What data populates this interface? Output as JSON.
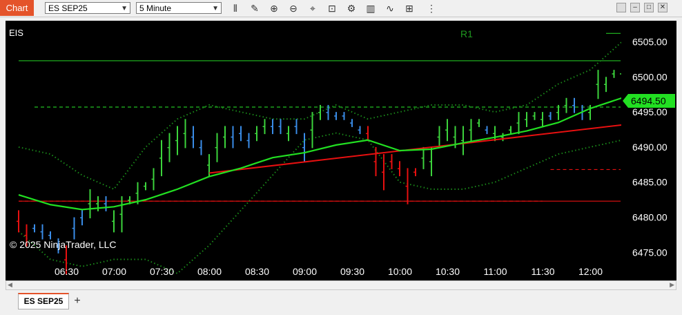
{
  "window": {
    "title": "Chart"
  },
  "toolbar": {
    "instrument": "ES SEP25",
    "interval": "5 Minute",
    "icons": [
      "bar-type-icon",
      "draw-pencil-icon",
      "zoom-in-icon",
      "zoom-out-icon",
      "crosshair-icon",
      "data-box-icon",
      "properties-icon",
      "strategies-icon",
      "indicators-icon",
      "templates-icon",
      "menu-icon"
    ]
  },
  "chart": {
    "instrument_label": "EIS",
    "copyright": "© 2025 NinjaTrader, LLC",
    "pivot_label": "R1",
    "current_price": "6494.50",
    "colors": {
      "up": "#3cd43c",
      "down": "#e81010",
      "neutral": "#3a8de8",
      "ema": "#22e022",
      "trend": "#e81010",
      "bands": "#1a8a1a",
      "current_price_bg": "#22e022"
    }
  },
  "chart_data": {
    "type": "bar",
    "instrument": "ES SEP25",
    "interval": "5 Minute",
    "x_ticks": [
      "06:30",
      "07:00",
      "07:30",
      "08:00",
      "08:30",
      "09:00",
      "09:30",
      "10:00",
      "10:30",
      "11:00",
      "11:30",
      "12:00"
    ],
    "y_ticks": [
      "6505.00",
      "6500.00",
      "6495.00",
      "6490.00",
      "6485.00",
      "6480.00",
      "6475.00"
    ],
    "ylim": [
      6471,
      6508
    ],
    "bars_per_tick": 6,
    "bars": [
      [
        6481,
        6478,
        "d"
      ],
      [
        6479,
        6476,
        "d"
      ],
      [
        6479,
        6478,
        "n"
      ],
      [
        6479,
        6477,
        "n"
      ],
      [
        6478,
        6477,
        "n"
      ],
      [
        6477,
        6475,
        "n"
      ],
      [
        6476,
        6472,
        "d"
      ],
      [
        6480,
        6477,
        "n"
      ],
      [
        6481,
        6479,
        "n"
      ],
      [
        6484,
        6480,
        "u"
      ],
      [
        6483,
        6481,
        "u"
      ],
      [
        6483,
        6481,
        "n"
      ],
      [
        6481,
        6478,
        "u"
      ],
      [
        6483,
        6478,
        "u"
      ],
      [
        6483,
        6482,
        "u"
      ],
      [
        6485,
        6482,
        "u"
      ],
      [
        6485,
        6484,
        "u"
      ],
      [
        6487,
        6484,
        "u"
      ],
      [
        6491,
        6486,
        "u"
      ],
      [
        6492,
        6488,
        "u"
      ],
      [
        6493,
        6489,
        "u"
      ],
      [
        6494,
        6490,
        "u"
      ],
      [
        6493,
        6490,
        "n"
      ],
      [
        6491,
        6489,
        "n"
      ],
      [
        6489,
        6486,
        "u"
      ],
      [
        6492,
        6488,
        "u"
      ],
      [
        6493,
        6490,
        "u"
      ],
      [
        6493,
        6490,
        "n"
      ],
      [
        6493,
        6491,
        "n"
      ],
      [
        6492,
        6490,
        "n"
      ],
      [
        6493,
        6491,
        "u"
      ],
      [
        6494,
        6492,
        "u"
      ],
      [
        6494,
        6492,
        "n"
      ],
      [
        6494,
        6492,
        "n"
      ],
      [
        6493,
        6491,
        "u"
      ],
      [
        6494,
        6492,
        "n"
      ],
      [
        6492,
        6488,
        "n"
      ],
      [
        6495,
        6490,
        "u"
      ],
      [
        6496,
        6494,
        "u"
      ],
      [
        6496,
        6494,
        "n"
      ],
      [
        6495,
        6494,
        "n"
      ],
      [
        6495,
        6494,
        "n"
      ],
      [
        6494,
        6493,
        "n"
      ],
      [
        6493,
        6492,
        "n"
      ],
      [
        6493,
        6491,
        "d"
      ],
      [
        6490,
        6486,
        "d"
      ],
      [
        6489,
        6484,
        "d"
      ],
      [
        6489,
        6487,
        "d"
      ],
      [
        6488,
        6486,
        "d"
      ],
      [
        6487,
        6482,
        "d"
      ],
      [
        6487,
        6486,
        "d"
      ],
      [
        6490,
        6487,
        "u"
      ],
      [
        6490,
        6486,
        "u"
      ],
      [
        6493,
        6490,
        "u"
      ],
      [
        6494,
        6491,
        "u"
      ],
      [
        6493,
        6490,
        "u"
      ],
      [
        6493,
        6489,
        "u"
      ],
      [
        6494,
        6491,
        "u"
      ],
      [
        6494,
        6493,
        "u"
      ],
      [
        6493,
        6492,
        "n"
      ],
      [
        6493,
        6491,
        "u"
      ],
      [
        6492,
        6491,
        "u"
      ],
      [
        6493,
        6492,
        "u"
      ],
      [
        6495,
        6492,
        "u"
      ],
      [
        6495,
        6493,
        "u"
      ],
      [
        6495,
        6494,
        "u"
      ],
      [
        6495,
        6493,
        "u"
      ],
      [
        6495,
        6494,
        "n"
      ],
      [
        6496,
        6494,
        "u"
      ],
      [
        6497,
        6495,
        "u"
      ],
      [
        6497,
        6495,
        "n"
      ],
      [
        6496,
        6494,
        "n"
      ],
      [
        6496,
        6494,
        "u"
      ],
      [
        6501,
        6497,
        "u"
      ],
      [
        6500,
        6498,
        "u"
      ],
      [
        6501,
        6500,
        "u"
      ],
      [
        6502,
        6499,
        "u"
      ],
      [
        6502,
        6501,
        "n"
      ],
      [
        6502,
        6500,
        "n"
      ],
      [
        6501,
        6500,
        "n"
      ],
      [
        6501,
        6500,
        "n"
      ],
      [
        6501,
        6500,
        "n"
      ],
      [
        6500,
        6499,
        "n"
      ],
      [
        6501,
        6500,
        "n"
      ],
      [
        6500,
        6498,
        "n"
      ],
      [
        6499,
        6497,
        "d"
      ],
      [
        6497,
        6496,
        "d"
      ],
      [
        6496,
        6496,
        "d"
      ],
      [
        6496,
        6487,
        "d"
      ],
      [
        6495,
        6489,
        "d"
      ],
      [
        6495,
        6494,
        "n"
      ]
    ],
    "ema": [
      [
        0,
        6483.2
      ],
      [
        4,
        6481.8
      ],
      [
        8,
        6481.1
      ],
      [
        12,
        6481.5
      ],
      [
        16,
        6482.5
      ],
      [
        20,
        6484.0
      ],
      [
        24,
        6485.8
      ],
      [
        28,
        6487.0
      ],
      [
        32,
        6488.5
      ],
      [
        36,
        6489.2
      ],
      [
        40,
        6490.3
      ],
      [
        44,
        6491.0
      ],
      [
        48,
        6489.5
      ],
      [
        52,
        6489.7
      ],
      [
        56,
        6490.6
      ],
      [
        60,
        6491.4
      ],
      [
        64,
        6492.3
      ],
      [
        68,
        6493.5
      ],
      [
        72,
        6495.5
      ],
      [
        76,
        6497.0
      ],
      [
        80,
        6497.8
      ],
      [
        84,
        6497.6
      ],
      [
        88,
        6496.8
      ],
      [
        90,
        6496.4
      ]
    ],
    "trend_line": [
      [
        24,
        6486.3
      ],
      [
        90,
        6495.0
      ]
    ],
    "bands_upper": [
      [
        0,
        6490
      ],
      [
        4,
        6489
      ],
      [
        8,
        6486
      ],
      [
        12,
        6484
      ],
      [
        16,
        6490
      ],
      [
        20,
        6494
      ],
      [
        24,
        6496
      ],
      [
        28,
        6495
      ],
      [
        32,
        6494
      ],
      [
        36,
        6494
      ],
      [
        40,
        6496
      ],
      [
        44,
        6494
      ],
      [
        48,
        6495
      ],
      [
        52,
        6496
      ],
      [
        56,
        6496
      ],
      [
        60,
        6495
      ],
      [
        64,
        6496
      ],
      [
        68,
        6499
      ],
      [
        72,
        6501
      ],
      [
        76,
        6505
      ],
      [
        80,
        6506
      ],
      [
        84,
        6505
      ],
      [
        86,
        6505
      ]
    ],
    "bands_lower": [
      [
        0,
        6478
      ],
      [
        4,
        6474
      ],
      [
        8,
        6473
      ],
      [
        12,
        6474
      ],
      [
        16,
        6474
      ],
      [
        20,
        6472
      ],
      [
        24,
        6476
      ],
      [
        28,
        6481
      ],
      [
        32,
        6486
      ],
      [
        36,
        6491
      ],
      [
        40,
        6492
      ],
      [
        44,
        6491
      ],
      [
        48,
        6485
      ],
      [
        52,
        6484
      ],
      [
        56,
        6484
      ],
      [
        60,
        6485
      ],
      [
        64,
        6487
      ],
      [
        68,
        6489
      ],
      [
        72,
        6490
      ],
      [
        76,
        6491
      ],
      [
        80,
        6491
      ],
      [
        84,
        6493
      ],
      [
        88,
        6494
      ],
      [
        90,
        6491
      ]
    ],
    "levels": [
      {
        "price": 6502.3,
        "from": 0,
        "to": 90,
        "style": "solid",
        "color": "#22c022"
      },
      {
        "price": 6506.2,
        "from": 74,
        "to": 90,
        "style": "solid",
        "color": "#22c022"
      },
      {
        "price": 6495.7,
        "from": 2,
        "to": 78,
        "style": "dashed",
        "color": "#22c022"
      },
      {
        "price": 6482.3,
        "from": 0,
        "to": 90,
        "style": "solid",
        "color": "#e81010"
      },
      {
        "price": 6482.3,
        "from": 0,
        "to": 66,
        "style": "dashed",
        "color": "#e81010"
      },
      {
        "price": 6486.8,
        "from": 67,
        "to": 87,
        "style": "dashed",
        "color": "#e81010"
      }
    ]
  },
  "tabs": [
    {
      "label": "ES SEP25",
      "active": true
    }
  ]
}
